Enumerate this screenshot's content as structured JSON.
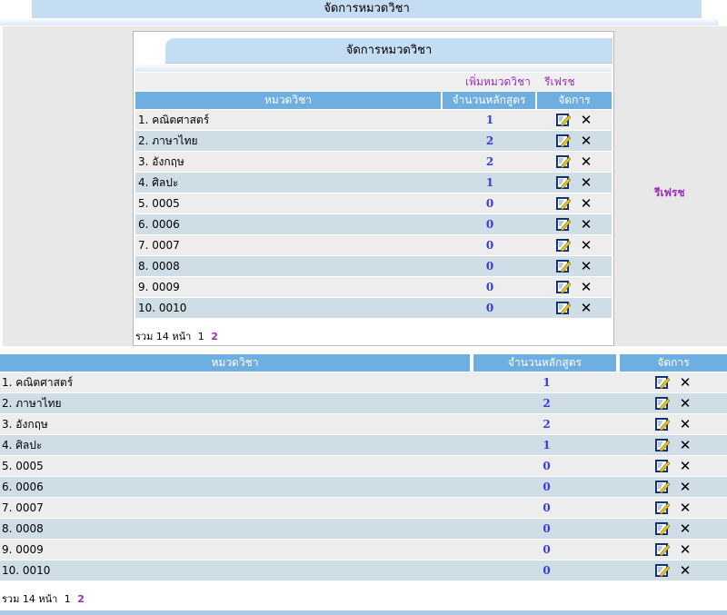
{
  "header": {
    "title": "จัดการหมวดวิชา"
  },
  "panel": {
    "title": "จัดการหมวดวิชา",
    "add_label": "เพิ่มหมวดวิชา",
    "refresh_label": "รีเฟรช"
  },
  "side": {
    "refresh_label": "รีเฟรช"
  },
  "table": {
    "columns": {
      "category": "หมวดวิชา",
      "count": "จำนวนหลักสูตร",
      "actions": "จัดการ"
    },
    "rows": [
      {
        "name": "1. คณิตศาสตร์",
        "count": "1"
      },
      {
        "name": "2. ภาษาไทย",
        "count": "2"
      },
      {
        "name": "3. อังกฤษ",
        "count": "2"
      },
      {
        "name": "4. ศิลปะ",
        "count": "1"
      },
      {
        "name": "5. 0005",
        "count": "0"
      },
      {
        "name": "6. 0006",
        "count": "0"
      },
      {
        "name": "7. 0007",
        "count": "0"
      },
      {
        "name": "8. 0008",
        "count": "0"
      },
      {
        "name": "9. 0009",
        "count": "0"
      },
      {
        "name": "10. 0010",
        "count": "0"
      }
    ]
  },
  "pager": {
    "summary": "รวม 14 หน้า",
    "current_page": "1",
    "next_page": "2"
  },
  "icons": {
    "edit": "edit-icon",
    "delete": "delete-icon"
  },
  "colors": {
    "header_blue": "#c5ddf3",
    "column_blue": "#6faee0",
    "link_purple": "#9a2fb8",
    "count_blue": "#3b3bd6"
  }
}
